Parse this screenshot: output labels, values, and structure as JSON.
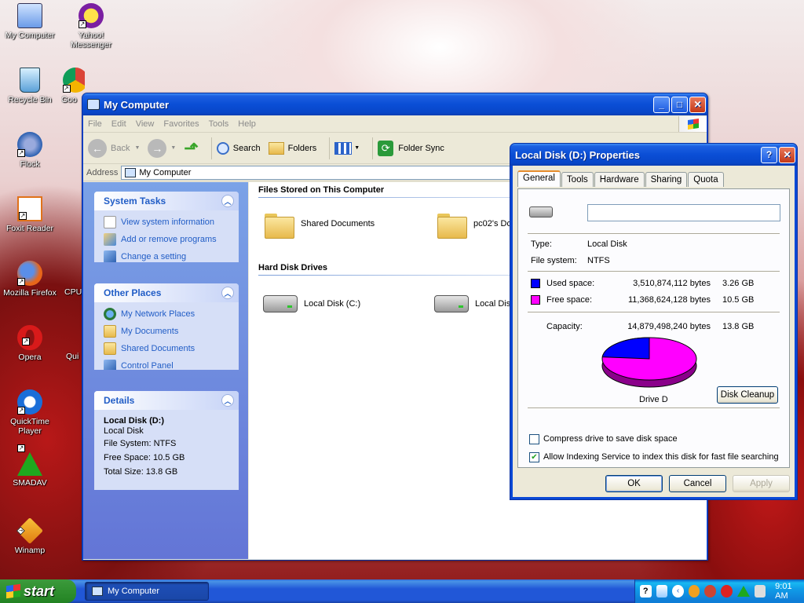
{
  "desktop": {
    "icons": [
      {
        "label": "My Computer"
      },
      {
        "label": "Yahoo! Messenger"
      },
      {
        "label": "Recycle Bin"
      },
      {
        "label": "Goo"
      },
      {
        "label": "Flock"
      },
      {
        "label": "Foxit Reader"
      },
      {
        "label": "Mozilla Firefox"
      },
      {
        "label": "CPU"
      },
      {
        "label": "Opera"
      },
      {
        "label": "Qui"
      },
      {
        "label": "QuickTime Player"
      },
      {
        "label": "SMADAV"
      },
      {
        "label": "Winamp"
      }
    ]
  },
  "explorer": {
    "title": "My Computer",
    "menu": [
      "File",
      "Edit",
      "View",
      "Favorites",
      "Tools",
      "Help"
    ],
    "toolbar": {
      "back": "Back",
      "search": "Search",
      "folders": "Folders",
      "folder_sync": "Folder Sync"
    },
    "address": {
      "label": "Address",
      "value": "My Computer"
    },
    "system_tasks": {
      "title": "System Tasks",
      "items": [
        "View system information",
        "Add or remove programs",
        "Change a setting"
      ]
    },
    "other_places": {
      "title": "Other Places",
      "items": [
        "My Network Places",
        "My Documents",
        "Shared Documents",
        "Control Panel"
      ]
    },
    "details": {
      "title": "Details",
      "name": "Local Disk (D:)",
      "type": "Local Disk",
      "file_system": "File System: NTFS",
      "free_space": "Free Space: 10.5 GB",
      "total_size": "Total Size: 13.8 GB"
    },
    "groups": {
      "files_stored": "Files Stored on This Computer",
      "hard_disk_drives": "Hard Disk Drives"
    },
    "items": {
      "shared_documents": "Shared Documents",
      "pc02_documents": "pc02's Do",
      "local_disk_c": "Local Disk (C:)",
      "local_disk_d": "Local Disk"
    }
  },
  "properties": {
    "title": "Local Disk (D:) Properties",
    "tabs": [
      "General",
      "Tools",
      "Hardware",
      "Sharing",
      "Quota"
    ],
    "label_value": "",
    "type_label": "Type:",
    "type_value": "Local Disk",
    "fs_label": "File system:",
    "fs_value": "NTFS",
    "used": {
      "label": "Used space:",
      "bytes": "3,510,874,112 bytes",
      "size": "3.26 GB",
      "color": "#0000ff"
    },
    "free": {
      "label": "Free space:",
      "bytes": "11,368,624,128 bytes",
      "size": "10.5 GB",
      "color": "#ff00ff"
    },
    "capacity": {
      "label": "Capacity:",
      "bytes": "14,879,498,240 bytes",
      "size": "13.8 GB"
    },
    "used_fraction": 0.236,
    "drive_label": "Drive D",
    "disk_cleanup": "Disk Cleanup",
    "compress_label": "Compress drive to save disk space",
    "compress_checked": false,
    "index_label": "Allow Indexing Service to index this disk for fast file searching",
    "index_checked": true,
    "ok": "OK",
    "cancel": "Cancel",
    "apply": "Apply"
  },
  "taskbar": {
    "start": "start",
    "task_label": "My Computer",
    "clock": "9:01 AM"
  }
}
